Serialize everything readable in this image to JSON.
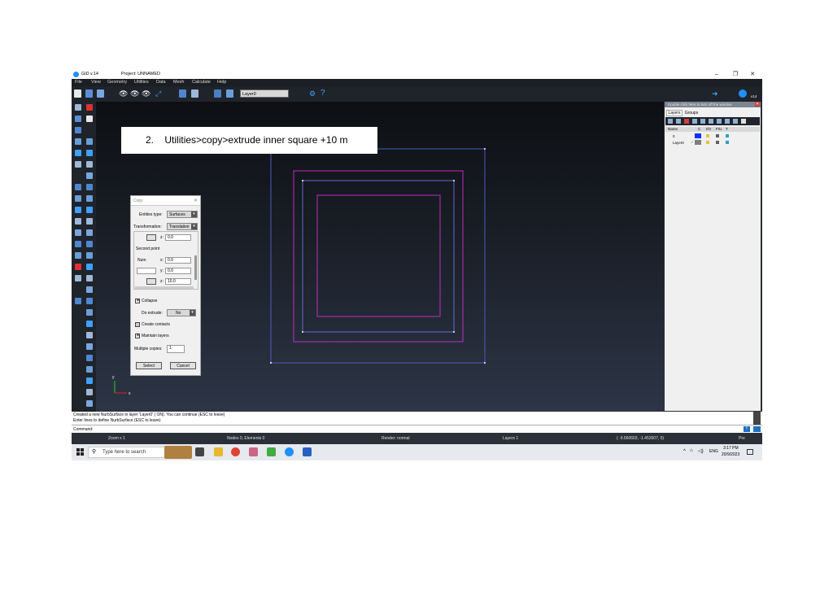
{
  "window": {
    "app_title": "GiD v.14",
    "project_title": "Project: UNNAMED",
    "minimize_glyph": "–",
    "maximize_glyph": "❐",
    "close_glyph": "✕"
  },
  "menu": [
    "File",
    "View",
    "Geometry",
    "Utilities",
    "Data",
    "Mesh",
    "Calculate",
    "Help"
  ],
  "toolbar": {
    "layer_select": "Layer0",
    "badge": "v14"
  },
  "annotation": {
    "step": "2.",
    "text": "Utilities>copy>extrude inner square +10 m"
  },
  "copy_dialog": {
    "title": "Copy",
    "entities_type_label": "Entities type:",
    "entities_type_value": "Surfaces",
    "transformation_label": "Transformation:",
    "transformation_value": "Translation",
    "first_z_label": "z:",
    "first_z_value": "0.0",
    "second_point_label": "Second point",
    "num_label": "Num",
    "x_label": "x:",
    "x_value": "0.0",
    "y_label": "y:",
    "y_value": "0.0",
    "z_label": "z:",
    "z_value": "10.0",
    "collapse_label": "Collapse",
    "do_extrude_label": "Do extrude:",
    "do_extrude_value": "No",
    "create_contacts_label": "Create contacts",
    "maintain_layers_label": "Maintain layers",
    "multiple_copies_label": "Multiple copies:",
    "multiple_copies_value": "1",
    "select_button": "Select",
    "cancel_button": "Cancel"
  },
  "layers_panel": {
    "header": "Double click here to turn off the window",
    "tabs": [
      "Layers",
      "Groups"
    ],
    "columns": [
      "Name",
      "C",
      "I/O",
      "F/U",
      "T"
    ],
    "rows": [
      {
        "name": "0",
        "color": "#1030ff"
      },
      {
        "name": "Layer0",
        "check": "✓",
        "color": "#7f7f7f"
      }
    ]
  },
  "messages": [
    "Created a new NurbSurface in layer 'Layer0' ( ON). You can continue (ESC to leave)",
    "Enter lines to define NurbSurface (ESC to leave)"
  ],
  "command": {
    "label": "Command:"
  },
  "statusbar": {
    "zoom": "Zoom x 1",
    "nodes_elements": "Nodes 0, Elements 0",
    "render": "Render: normal",
    "layers": "Layers 1",
    "coords": "( -9.560603, -1.452607, 0)",
    "pre": "Pre"
  },
  "axes": {
    "x": "x",
    "y": "y"
  },
  "taskbar": {
    "search_placeholder": "Type here to search",
    "language": "ENG",
    "time": "3:17 PM",
    "date": "20/9/2023"
  },
  "colors": {
    "outer_square": "#5560d8",
    "magenta_squares": "#d030d0",
    "inner_blue_square": "#7070e0",
    "accent_blue": "#1e90ff"
  }
}
